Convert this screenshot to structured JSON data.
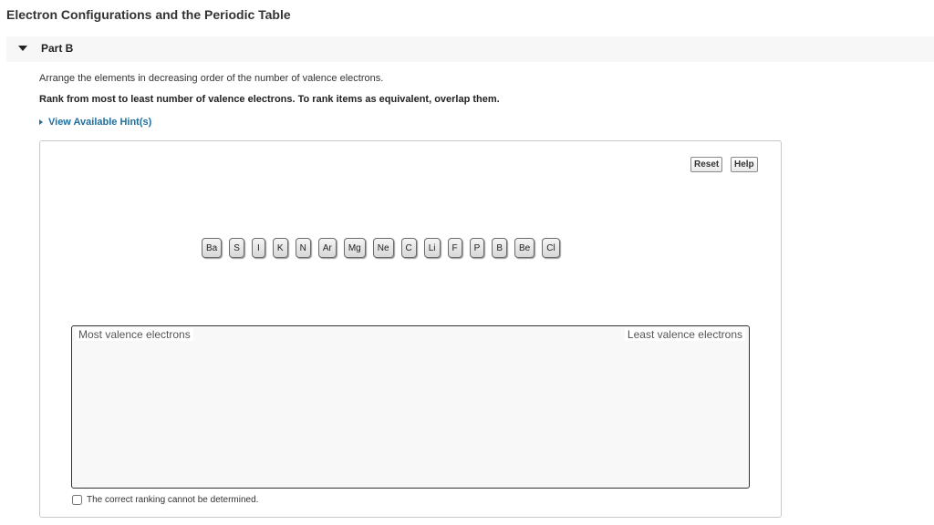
{
  "page": {
    "title": "Electron Configurations and the Periodic Table"
  },
  "part": {
    "label": "Part B"
  },
  "question": {
    "instructions": "Arrange the elements in decreasing order of the number of valence electrons.",
    "rank_rule": "Rank from most to least number of valence electrons. To rank items as equivalent, overlap them.",
    "hint_link": "View Available Hint(s)"
  },
  "toolbar": {
    "reset_label": "Reset",
    "help_label": "Help"
  },
  "tiles": [
    "Ba",
    "S",
    "I",
    "K",
    "N",
    "Ar",
    "Mg",
    "Ne",
    "C",
    "Li",
    "F",
    "P",
    "B",
    "Be",
    "Cl"
  ],
  "ranking": {
    "left_label": "Most valence electrons",
    "right_label": "Least valence electrons"
  },
  "cannot_determine": {
    "label": "The correct ranking cannot be determined.",
    "checked": false
  },
  "colors": {
    "link": "#1f6f9f",
    "header_bg": "#f7f7f7",
    "panel_border": "#c8c8c8"
  }
}
